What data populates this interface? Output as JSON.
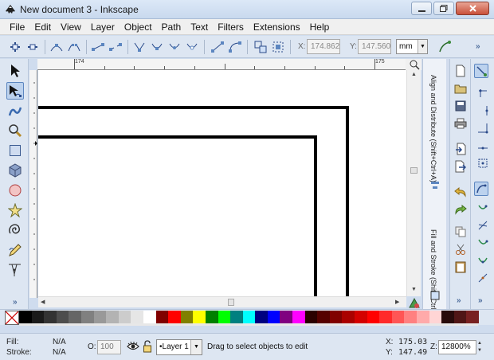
{
  "window": {
    "title": "New document 3 - Inkscape"
  },
  "menu": [
    "File",
    "Edit",
    "View",
    "Layer",
    "Object",
    "Path",
    "Text",
    "Filters",
    "Extensions",
    "Help"
  ],
  "commands": {
    "x_label": "X:",
    "x_value": "174.862",
    "y_label": "Y:",
    "y_value": "147.560",
    "unit": "mm",
    "more": "»"
  },
  "rulers": {
    "top_left_label": "174",
    "top_right_label": "175"
  },
  "dock": {
    "tabs": [
      "Align and Distribute (Shift+Ctrl+A)",
      "Fill and Stroke (Shift+Ctrl+F)"
    ]
  },
  "toolbox": {
    "more": "»"
  },
  "statusbar": {
    "fill_label": "Fill:",
    "fill_value": "N/A",
    "stroke_label": "Stroke:",
    "stroke_value": "N/A",
    "opacity_label": "O:",
    "opacity_value": "100",
    "layer": "•Layer 1",
    "message": "Drag to select objects to edit",
    "x_label": "X:",
    "x_value": "175.03",
    "y_label": "Y:",
    "y_value": "147.49",
    "zoom_label": "Z:",
    "zoom_value": "12800%"
  },
  "palette_colors": [
    "#000000",
    "#1a1a1a",
    "#333333",
    "#4d4d4d",
    "#666666",
    "#808080",
    "#999999",
    "#b3b3b3",
    "#cccccc",
    "#e6e6e6",
    "#ffffff",
    "#800000",
    "#ff0000",
    "#808000",
    "#ffff00",
    "#008000",
    "#00ff00",
    "#008080",
    "#00ffff",
    "#000080",
    "#0000ff",
    "#800080",
    "#ff00ff",
    "#2b0000",
    "#550000",
    "#800000",
    "#aa0000",
    "#d40000",
    "#ff0000",
    "#ff2a2a",
    "#ff5555",
    "#ff8080",
    "#ffaaaa",
    "#ffd5d5",
    "#280b0b",
    "#501616",
    "#782121"
  ]
}
